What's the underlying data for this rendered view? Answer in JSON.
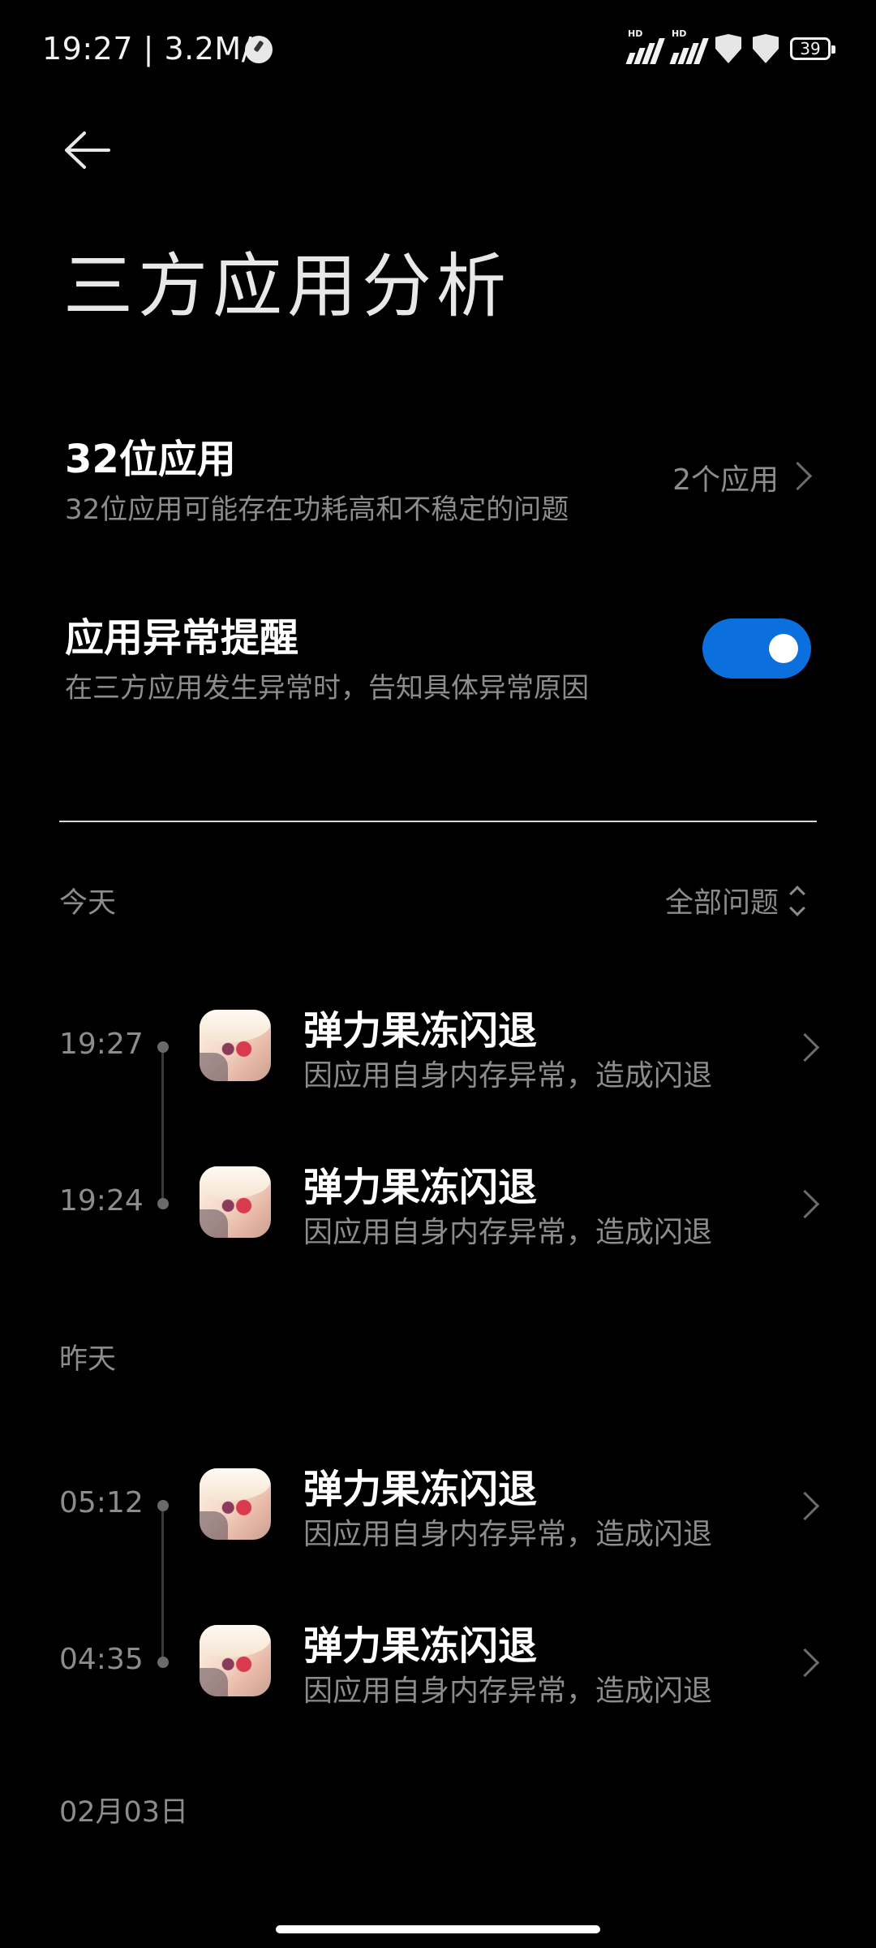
{
  "status_bar": {
    "time_speed": "19:27 | 3.2M/s",
    "signal1_label": "HD",
    "signal2_label": "HD",
    "battery": "39"
  },
  "header": {
    "back_icon": "arrow-left-icon",
    "title": "三方应用分析"
  },
  "settings": {
    "apps32": {
      "title": "32位应用",
      "subtitle": "32位应用可能存在功耗高和不稳定的问题",
      "value": "2个应用"
    },
    "anomaly_alert": {
      "title": "应用异常提醒",
      "subtitle": "在三方应用发生异常时，告知具体异常原因",
      "enabled": true
    }
  },
  "filter": {
    "label": "全部问题"
  },
  "sections": [
    {
      "label": "今天",
      "items": [
        {
          "time": "19:27",
          "title": "弹力果冻闪退",
          "subtitle": "因应用自身内存异常，造成闪退"
        },
        {
          "time": "19:24",
          "title": "弹力果冻闪退",
          "subtitle": "因应用自身内存异常，造成闪退"
        }
      ]
    },
    {
      "label": "昨天",
      "items": [
        {
          "time": "05:12",
          "title": "弹力果冻闪退",
          "subtitle": "因应用自身内存异常，造成闪退"
        },
        {
          "time": "04:35",
          "title": "弹力果冻闪退",
          "subtitle": "因应用自身内存异常，造成闪退"
        }
      ]
    },
    {
      "label": "02月03日",
      "items": []
    }
  ],
  "colors": {
    "background": "#000000",
    "accent_toggle": "#0b6fde",
    "secondary_text": "#8c8c8c"
  }
}
